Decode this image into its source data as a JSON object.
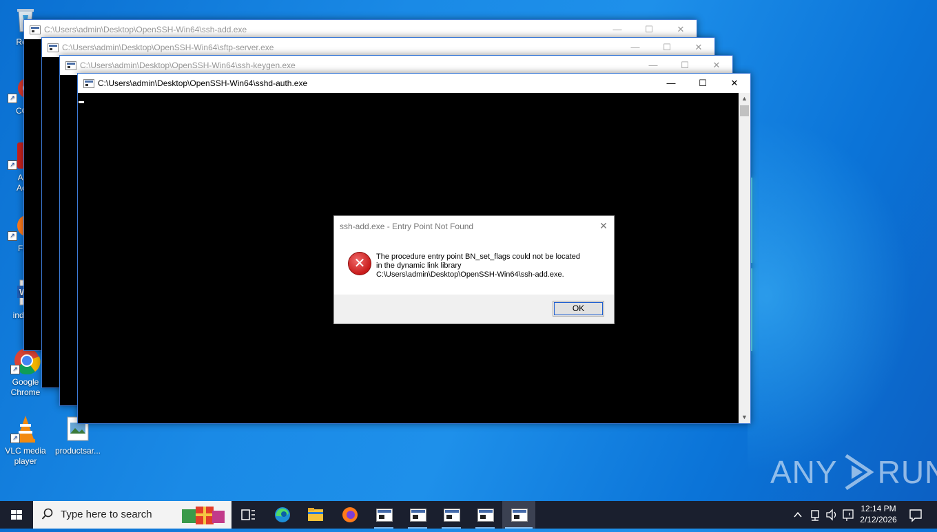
{
  "desktop": {
    "icons": [
      {
        "id": "recycle",
        "label": "Recy"
      },
      {
        "id": "ccleaner",
        "label": "CCl"
      },
      {
        "id": "adobe",
        "label": "Ad\nAcr"
      },
      {
        "id": "firefox",
        "label": "Fir"
      },
      {
        "id": "word",
        "label": "index"
      },
      {
        "id": "chrome",
        "label": "Google Chrome"
      },
      {
        "id": "vlc",
        "label": "VLC media player"
      },
      {
        "id": "productsar",
        "label": "productsar..."
      }
    ]
  },
  "windows": [
    {
      "title": "C:\\Users\\admin\\Desktop\\OpenSSH-Win64\\ssh-add.exe"
    },
    {
      "title": "C:\\Users\\admin\\Desktop\\OpenSSH-Win64\\sftp-server.exe"
    },
    {
      "title": "C:\\Users\\admin\\Desktop\\OpenSSH-Win64\\ssh-keygen.exe"
    },
    {
      "title": "C:\\Users\\admin\\Desktop\\OpenSSH-Win64\\sshd-auth.exe"
    }
  ],
  "window_controls": {
    "minimize": "—",
    "maximize": "☐",
    "close": "✕"
  },
  "dialog": {
    "title": "ssh-add.exe - Entry Point Not Found",
    "close": "✕",
    "message_line1": "The procedure entry point BN_set_flags could not be located",
    "message_line2": "in the dynamic link library",
    "message_line3": "C:\\Users\\admin\\Desktop\\OpenSSH-Win64\\ssh-add.exe.",
    "ok_label": "OK"
  },
  "watermark": {
    "left": "ANY",
    "right": "RUN"
  },
  "taskbar": {
    "search_placeholder": "Type here to search",
    "time": "12:14 PM",
    "date": "2/12/2026"
  }
}
